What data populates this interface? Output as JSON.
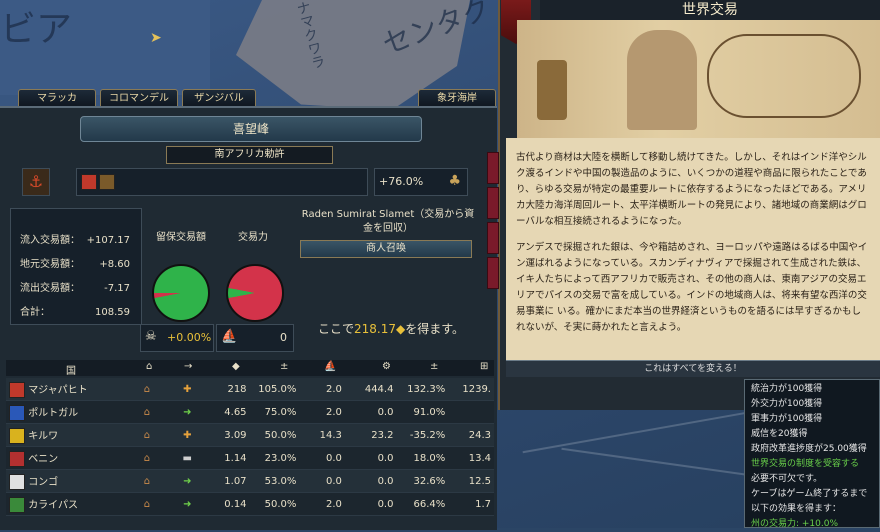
{
  "map": {
    "labels": [
      "ビア",
      "センタク",
      "ナマクワラ"
    ]
  },
  "tabs": [
    "マラッカ",
    "コロマンデル",
    "ザンジバル",
    "象牙海岸"
  ],
  "node": {
    "title": "喜望峰",
    "subtitle": "南アフリカ勅許",
    "power_change": "+76.0%",
    "stats": [
      {
        "label": "流入交易額：",
        "value": "+107.17"
      },
      {
        "label": "地元交易額：",
        "value": "+8.60"
      },
      {
        "label": "流出交易額：",
        "value": "-7.17"
      },
      {
        "label": "合計：",
        "value": "108.59"
      }
    ],
    "retained_label": "留保交易額",
    "power_label": "交易力",
    "retained_value": "+0.00%",
    "ships_value": "0",
    "merchant_name": "Raden Sumirat Slamet（交易から資金を回収）",
    "recall_button": "商人召喚",
    "gain_prefix": "ここで",
    "gain_value": "218.17",
    "gain_suffix": "を得ます。",
    "colors": {
      "pie_green": "#2fb34a",
      "pie_red": "#d3334a"
    }
  },
  "table": {
    "header_country": "国",
    "rows": [
      {
        "country": "マジャパヒト",
        "flag": "#c0392b",
        "action": "plus",
        "v1": "218",
        "v2": "105.0%",
        "v3": "2.0",
        "v4": "444.4",
        "v5": "132.3%",
        "v6": "1239."
      },
      {
        "country": "ポルトガル",
        "flag": "#2a58b8",
        "action": "arrow",
        "v1": "4.65",
        "v2": "75.0%",
        "v3": "2.0",
        "v4": "0.0",
        "v5": "91.0%",
        "v6": ""
      },
      {
        "country": "キルワ",
        "flag": "#d9b21e",
        "action": "plus",
        "v1": "3.09",
        "v2": "50.0%",
        "v3": "14.3",
        "v4": "23.2",
        "v5": "-35.2%",
        "v6": "24.3"
      },
      {
        "country": "ベニン",
        "flag": "#b33030",
        "action": "minus",
        "v1": "1.14",
        "v2": "23.0%",
        "v3": "0.0",
        "v4": "0.0",
        "v5": "18.0%",
        "v6": "13.4"
      },
      {
        "country": "コンゴ",
        "flag": "#e0e0e0",
        "action": "arrow",
        "v1": "1.07",
        "v2": "53.0%",
        "v3": "0.0",
        "v4": "0.0",
        "v5": "32.6%",
        "v6": "12.5"
      },
      {
        "country": "カライパス",
        "flag": "#3a8a3a",
        "action": "arrow",
        "v1": "0.14",
        "v2": "50.0%",
        "v3": "2.0",
        "v4": "0.0",
        "v5": "66.4%",
        "v6": "1.7"
      }
    ]
  },
  "event": {
    "title": "世界交易",
    "para1": "古代より商材は大陸を横断して移動し続けてきた。しかし、それはインド洋やシルク渡るインドや中国の製造品のように、いくつかの道程や商品に限られたことであり、らゆる交易が特定の最重要ルートに依存するようになったほどである。アメリカ大陸カ海洋周回ルート、太平洋横断ルートの発見により、諸地域の商業網はグローバルな相互接続されるようになった。",
    "para2": "アンデスで採掘された銀は、今や箱詰めされ、ヨーロッパや遠路はるばる中国やイン運ばれるようになっている。スカンディナヴィアで採掘されて生成された鉄は、イキ人たちによって西アフリカで販売され、その他の商人は、東南アジアの交易エリアでパイスの交易で富を成している。インドの地域商人は、将来有望な西洋の交易事業に いる。確かにまだ本当の世界経済というものを語るには早すぎるかもしれないが、そ実に蒔かれたと言えよう。",
    "option_button": "これはすべてを変える！"
  },
  "tooltip": {
    "lines": [
      "統治力が100獲得",
      "外交力が100獲得",
      "軍事力が100獲得",
      "威信を20獲得",
      "政府改革進捗度が25.00獲得",
      "世界交易の制度を受容する",
      "必要不可欠です。",
      "ケーブはゲーム終了するまで",
      "以下の効果を得ます：",
      "州の交易力: +10.0%"
    ]
  }
}
